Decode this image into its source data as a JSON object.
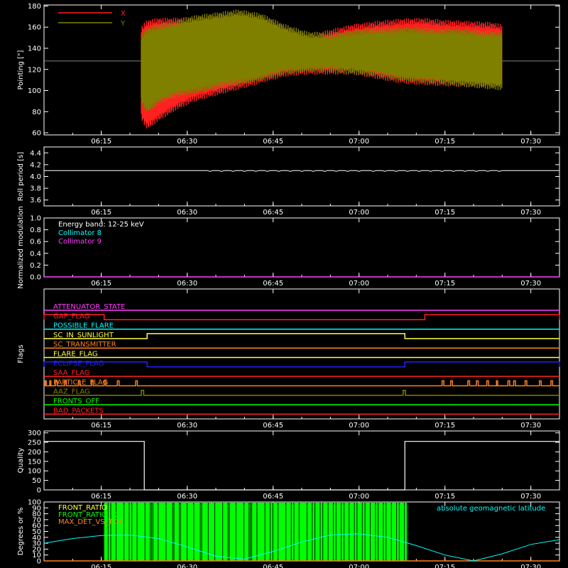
{
  "colors": {
    "bg": "#000000",
    "axis": "#ffffff",
    "red": "#ff2020",
    "olive": "#808000",
    "cyan": "#00ffff",
    "magenta": "#ff40ff",
    "green": "#00ff00",
    "orange": "#ff8020",
    "yellow": "#ffff40",
    "blue": "#2020ff",
    "white": "#ffffff",
    "grey": "#808080"
  },
  "chart_data": [
    {
      "type": "line",
      "ylabel": "Pointing [\"]",
      "ylim": [
        58,
        181
      ],
      "yticks": [
        60,
        80,
        100,
        120,
        140,
        160,
        180
      ],
      "xticks": [
        "06:15",
        "06:30",
        "06:45",
        "07:00",
        "07:15",
        "07:30"
      ],
      "xlim_minutes": [
        0,
        90
      ],
      "reference_line": 128,
      "legend": [
        "X",
        "Y"
      ],
      "series": [
        {
          "name": "X",
          "color": "red",
          "x": [
            17,
            18,
            20,
            23,
            26,
            30,
            34,
            38,
            42,
            46,
            50,
            54,
            58,
            62,
            66,
            70,
            74,
            78,
            80
          ],
          "upper": [
            158,
            164,
            166,
            166,
            167,
            168,
            170,
            168,
            158,
            150,
            155,
            160,
            163,
            165,
            166,
            164,
            163,
            162,
            160
          ],
          "lower": [
            75,
            66,
            74,
            84,
            92,
            98,
            104,
            110,
            116,
            118,
            118,
            118,
            114,
            110,
            108,
            107,
            106,
            106,
            106
          ]
        },
        {
          "name": "Y",
          "color": "olive",
          "x": [
            17,
            18,
            20,
            23,
            26,
            30,
            34,
            38,
            42,
            46,
            50,
            54,
            58,
            62,
            66,
            70,
            74,
            78,
            80
          ],
          "upper": [
            150,
            156,
            160,
            164,
            168,
            171,
            174,
            170,
            160,
            153,
            152,
            154,
            157,
            157,
            157,
            156,
            155,
            154,
            153
          ],
          "lower": [
            90,
            82,
            90,
            96,
            100,
            104,
            108,
            112,
            118,
            120,
            120,
            118,
            116,
            112,
            110,
            108,
            106,
            104,
            103
          ]
        }
      ]
    },
    {
      "type": "line",
      "ylabel": "Roll period [s]",
      "ylim": [
        3.5,
        4.5
      ],
      "yticks": [
        3.6,
        3.8,
        4.0,
        4.2,
        4.4
      ],
      "xticks": [
        "06:15",
        "06:30",
        "06:45",
        "07:00",
        "07:15",
        "07:30"
      ],
      "series": [
        {
          "name": "",
          "x": [
            0,
            90
          ],
          "values": [
            4.1,
            4.1
          ]
        }
      ]
    },
    {
      "type": "line",
      "ylabel": "Normalized modulation",
      "ylim": [
        0,
        1
      ],
      "yticks": [
        0.0,
        0.2,
        0.4,
        0.6,
        0.8,
        1.0
      ],
      "xticks": [
        "06:15",
        "06:30",
        "06:45",
        "07:00",
        "07:15",
        "07:30"
      ],
      "legend": [
        "Energy band: 12-25 keV",
        "Collimator 8",
        "Collimator 9"
      ],
      "series": [
        {
          "name": "Collimator 8",
          "x": [
            0,
            90
          ],
          "values": [
            0,
            0
          ]
        },
        {
          "name": "Collimator 9",
          "x": [
            0,
            90
          ],
          "values": [
            0,
            0
          ]
        }
      ]
    },
    {
      "type": "line",
      "ylabel": "Flags",
      "xticks": [
        "06:15",
        "06:30",
        "06:45",
        "07:00",
        "07:15",
        "07:30"
      ],
      "flags": [
        {
          "name": "ATTENUATOR_STATE",
          "color": "magenta",
          "on": []
        },
        {
          "name": "GAP_FLAG",
          "color": "red",
          "on": [
            [
              0,
              10.5
            ],
            [
              66.5,
              90
            ]
          ]
        },
        {
          "name": "POSSIBLE_FLARE",
          "color": "cyan",
          "on": []
        },
        {
          "name": "SC_IN_SUNLIGHT",
          "color": "yellow",
          "on": [
            [
              18,
              63
            ]
          ]
        },
        {
          "name": "SC_TRANSMITTER",
          "color": "orange",
          "on": []
        },
        {
          "name": "FLARE_FLAG",
          "color": "yellow",
          "on": []
        },
        {
          "name": "ECLIPSE_FLAG",
          "color": "blue",
          "on": [
            [
              0,
              18
            ],
            [
              63,
              90
            ]
          ]
        },
        {
          "name": "SAA_FLAG",
          "color": "red",
          "on": []
        },
        {
          "name": "PARTICLE_FLAG",
          "color": "orange",
          "on": [
            [
              0.2,
              0.4
            ],
            [
              1,
              1.2
            ],
            [
              2,
              2.3
            ],
            [
              3.6,
              3.9
            ],
            [
              6,
              6.3
            ],
            [
              8.3,
              8.6
            ],
            [
              10.5,
              10.8
            ],
            [
              12.8,
              13.1
            ],
            [
              16,
              16.3
            ],
            [
              69.5,
              69.8
            ],
            [
              71,
              71.3
            ],
            [
              74,
              74.3
            ],
            [
              75.5,
              75.8
            ],
            [
              77.3,
              77.6
            ],
            [
              79,
              79.2
            ],
            [
              81,
              81.3
            ],
            [
              82,
              82.3
            ],
            [
              84,
              84.3
            ],
            [
              86.5,
              86.8
            ],
            [
              88.5,
              88.8
            ]
          ]
        },
        {
          "name": "AAZ_FLAG",
          "color": "olive",
          "on": [
            [
              17,
              17.4
            ],
            [
              62.7,
              63.1
            ]
          ]
        },
        {
          "name": "FRONTS_OFF",
          "color": "green",
          "on": []
        },
        {
          "name": "BAD_PACKETS",
          "color": "red",
          "on": []
        }
      ]
    },
    {
      "type": "line",
      "ylabel": "Quality",
      "ylim": [
        0,
        310
      ],
      "yticks": [
        0,
        50,
        100,
        150,
        200,
        250,
        300
      ],
      "xticks": [
        "06:15",
        "06:30",
        "06:45",
        "07:00",
        "07:15",
        "07:30"
      ],
      "series": [
        {
          "name": "",
          "x": [
            0,
            17.5,
            17.5,
            63,
            63,
            90
          ],
          "values": [
            255,
            255,
            0,
            0,
            255,
            255
          ]
        }
      ]
    },
    {
      "type": "line",
      "ylabel": "Degrees or %",
      "ylim": [
        0,
        100
      ],
      "yticks": [
        0,
        10,
        20,
        30,
        40,
        50,
        60,
        70,
        80,
        90,
        100
      ],
      "xticks": [
        "06:15",
        "06:30",
        "06:45",
        "07:00",
        "07:15",
        "07:30"
      ],
      "legend": [
        "FRONT_RATIO",
        "FRONT_RATIO_1225",
        "MAX_DET_VS_TOT"
      ],
      "right_label": "absolute geomagnetic latitude",
      "green_band": [
        10.5,
        63.5
      ],
      "series": [
        {
          "name": "absolute geomagnetic latitude",
          "color": "cyan",
          "x": [
            0,
            5,
            10,
            15,
            20,
            25,
            30,
            35,
            40,
            45,
            50,
            55,
            60,
            65,
            70,
            75,
            80,
            85,
            90
          ],
          "values": [
            30,
            38,
            43,
            44,
            38,
            24,
            8,
            3,
            16,
            32,
            44,
            46,
            40,
            26,
            10,
            0,
            12,
            28,
            36
          ]
        }
      ]
    }
  ]
}
